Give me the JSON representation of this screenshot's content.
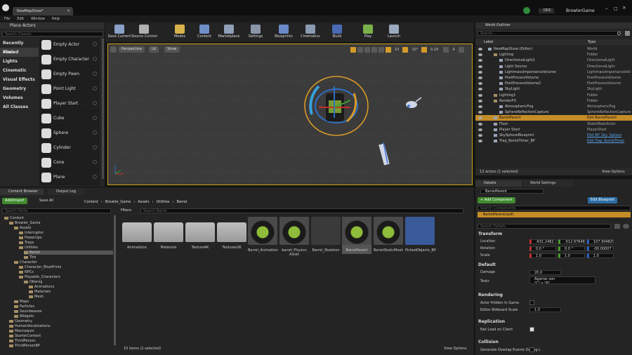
{
  "window": {
    "tab_title": "NewMapShow*",
    "project": "BrowlerGame",
    "ddc_label": "DDC",
    "accent": "#c9a318"
  },
  "menu": [
    "File",
    "Edit",
    "Window",
    "Help"
  ],
  "place_actors": {
    "title": "Place Actors",
    "search_placeholder": "Search Classes",
    "categories": [
      "Recently Placed",
      "Basic",
      "Lights",
      "Cinematic",
      "Visual Effects",
      "Geometry",
      "Volumes",
      "All Classes"
    ],
    "items": [
      "Empty Actor",
      "Empty Character",
      "Empty Pawn",
      "Point Light",
      "Player Start",
      "Cube",
      "Sphere",
      "Cylinder",
      "Cone",
      "Plane"
    ]
  },
  "toolbar": [
    "Save Current",
    "Source Control",
    "Modes",
    "Content",
    "Marketplace",
    "Settings",
    "Blueprints",
    "Cinematics",
    "Build",
    "Play",
    "Launch"
  ],
  "viewport": {
    "perspective": "Perspective",
    "lit": "Lit",
    "show": "Show",
    "snap1": "10",
    "snap2": "10°",
    "snap3": "0.25",
    "camera_speed": "4"
  },
  "outliner": {
    "title": "World Outliner",
    "search_placeholder": "Search...",
    "col_label": "Label",
    "col_type": "Type",
    "rows": [
      {
        "label": "NewMapShow (Editor)",
        "type": "World",
        "indent": 0
      },
      {
        "label": "Lighting",
        "type": "Folder",
        "indent": 1
      },
      {
        "label": "DirectionalLight2",
        "type": "DirectionalLight",
        "indent": 2
      },
      {
        "label": "Light Source",
        "type": "DirectionalLight",
        "indent": 2
      },
      {
        "label": "LightmassImportanceVolume",
        "type": "LightmassImportanceVol",
        "indent": 2
      },
      {
        "label": "PostProcessVolume",
        "type": "PostProcessVolume",
        "indent": 2
      },
      {
        "label": "PostProcessVolume2",
        "type": "PostProcessVolume",
        "indent": 2
      },
      {
        "label": "SkyLight",
        "type": "SkyLight",
        "indent": 2
      },
      {
        "label": "Lighting1",
        "type": "Folder",
        "indent": 1
      },
      {
        "label": "RenderFX",
        "type": "Folder",
        "indent": 1
      },
      {
        "label": "AtmosphericFog",
        "type": "AtmosphericFog",
        "indent": 2
      },
      {
        "label": "SphereReflectionCapture",
        "type": "SphereReflectionCapture",
        "indent": 2
      },
      {
        "label": "BarrelParent",
        "type": "Edit BarrelParent",
        "indent": 1,
        "selected": true
      },
      {
        "label": "Floor",
        "type": "StaticMeshActor",
        "indent": 1
      },
      {
        "label": "Player Start",
        "type": "PlayerStart",
        "indent": 1
      },
      {
        "label": "SkySphereBlueprint",
        "type": "Edit BP_Sky_Sphere",
        "indent": 1,
        "link": true
      },
      {
        "label": "Trap_BombTimer_BP",
        "type": "Edit Trap_BombTimer",
        "indent": 1,
        "link": true
      }
    ],
    "footer": "13 actors (1 selected)",
    "view_options": "View Options"
  },
  "details": {
    "tab_details": "Details",
    "tab_world": "World Settings",
    "name_value": "BarrelParent",
    "add_component": "+ Add Component",
    "edit_blueprint": "Edit Blueprint",
    "component_search": "Search Components",
    "self_label": "BarrelParent(self)",
    "search_details": "Search Details",
    "transform": "Transform",
    "location": "Location",
    "rotation": "Rotation",
    "scale": "Scale",
    "loc": [
      "-631.2482",
      "-512.976484",
      "107.904825"
    ],
    "rot": [
      "0.0 °",
      "0.0 °",
      "-00.00007 °"
    ],
    "scl": [
      "1.0",
      "1.0",
      "1.0"
    ],
    "default": "Default",
    "damage_label": "Damage",
    "damage_value": "20.0",
    "texts_label": "Texts",
    "texts_value": "Agarrar son\n\"C\" x \"R\"",
    "rendering": "Rendering",
    "hidden_label": "Actor Hidden In Game",
    "billboard_label": "Editor Billboard Scale",
    "billboard_value": "1.0",
    "replication": "Replication",
    "netload_label": "Net Load on Client",
    "collision": "Collision",
    "overlap_label": "Generate Overlap Events During L"
  },
  "content_browser": {
    "tab_cb": "Content Browser",
    "tab_log": "Output Log",
    "add_import": "Add/Import",
    "save_all": "Save All",
    "path": [
      "Content",
      "Browler_Game",
      "Assets",
      "Utilities",
      "Barrel"
    ],
    "search_paths": "Search Paths",
    "filters": "Filters",
    "search_assets": "Search Barrel",
    "tree": [
      {
        "label": "Content",
        "indent": 0
      },
      {
        "label": "Browler_Game",
        "indent": 1
      },
      {
        "label": "Assets",
        "indent": 2
      },
      {
        "label": "Interruptor",
        "indent": 3
      },
      {
        "label": "PowerUps",
        "indent": 3
      },
      {
        "label": "Traps",
        "indent": 3
      },
      {
        "label": "Utilities",
        "indent": 3
      },
      {
        "label": "Barrel",
        "indent": 4,
        "selected": true
      },
      {
        "label": "Tire",
        "indent": 4
      },
      {
        "label": "Character",
        "indent": 2
      },
      {
        "label": "Character_BluePrints",
        "indent": 3
      },
      {
        "label": "NPCs",
        "indent": 3
      },
      {
        "label": "Playable_Characters",
        "indent": 3
      },
      {
        "label": "Oberog",
        "indent": 4
      },
      {
        "label": "Animations",
        "indent": 5
      },
      {
        "label": "Materials",
        "indent": 5
      },
      {
        "label": "Mesh",
        "indent": 5
      },
      {
        "label": "Maps",
        "indent": 2
      },
      {
        "label": "Particles",
        "indent": 2
      },
      {
        "label": "Soundwaves",
        "indent": 2
      },
      {
        "label": "Widgets",
        "indent": 2
      },
      {
        "label": "Geometry",
        "indent": 1
      },
      {
        "label": "HumanVocalizations",
        "indent": 1
      },
      {
        "label": "Mannequin",
        "indent": 1
      },
      {
        "label": "StarterContent",
        "indent": 1
      },
      {
        "label": "ThirdPerson",
        "indent": 1
      },
      {
        "label": "ThirdPersonBP",
        "indent": 1
      }
    ],
    "assets": [
      "Animations",
      "Materials",
      "Texture4K",
      "Textures2K",
      "Barrel_Animation",
      "barrel_Physics\nAsset",
      "Barrel_Skeleton",
      "BarrelParent",
      "BarrelStaticMesh",
      "PickedObjects_BP"
    ],
    "footer": "10 items (1 selected)",
    "view_options": "View Options"
  }
}
